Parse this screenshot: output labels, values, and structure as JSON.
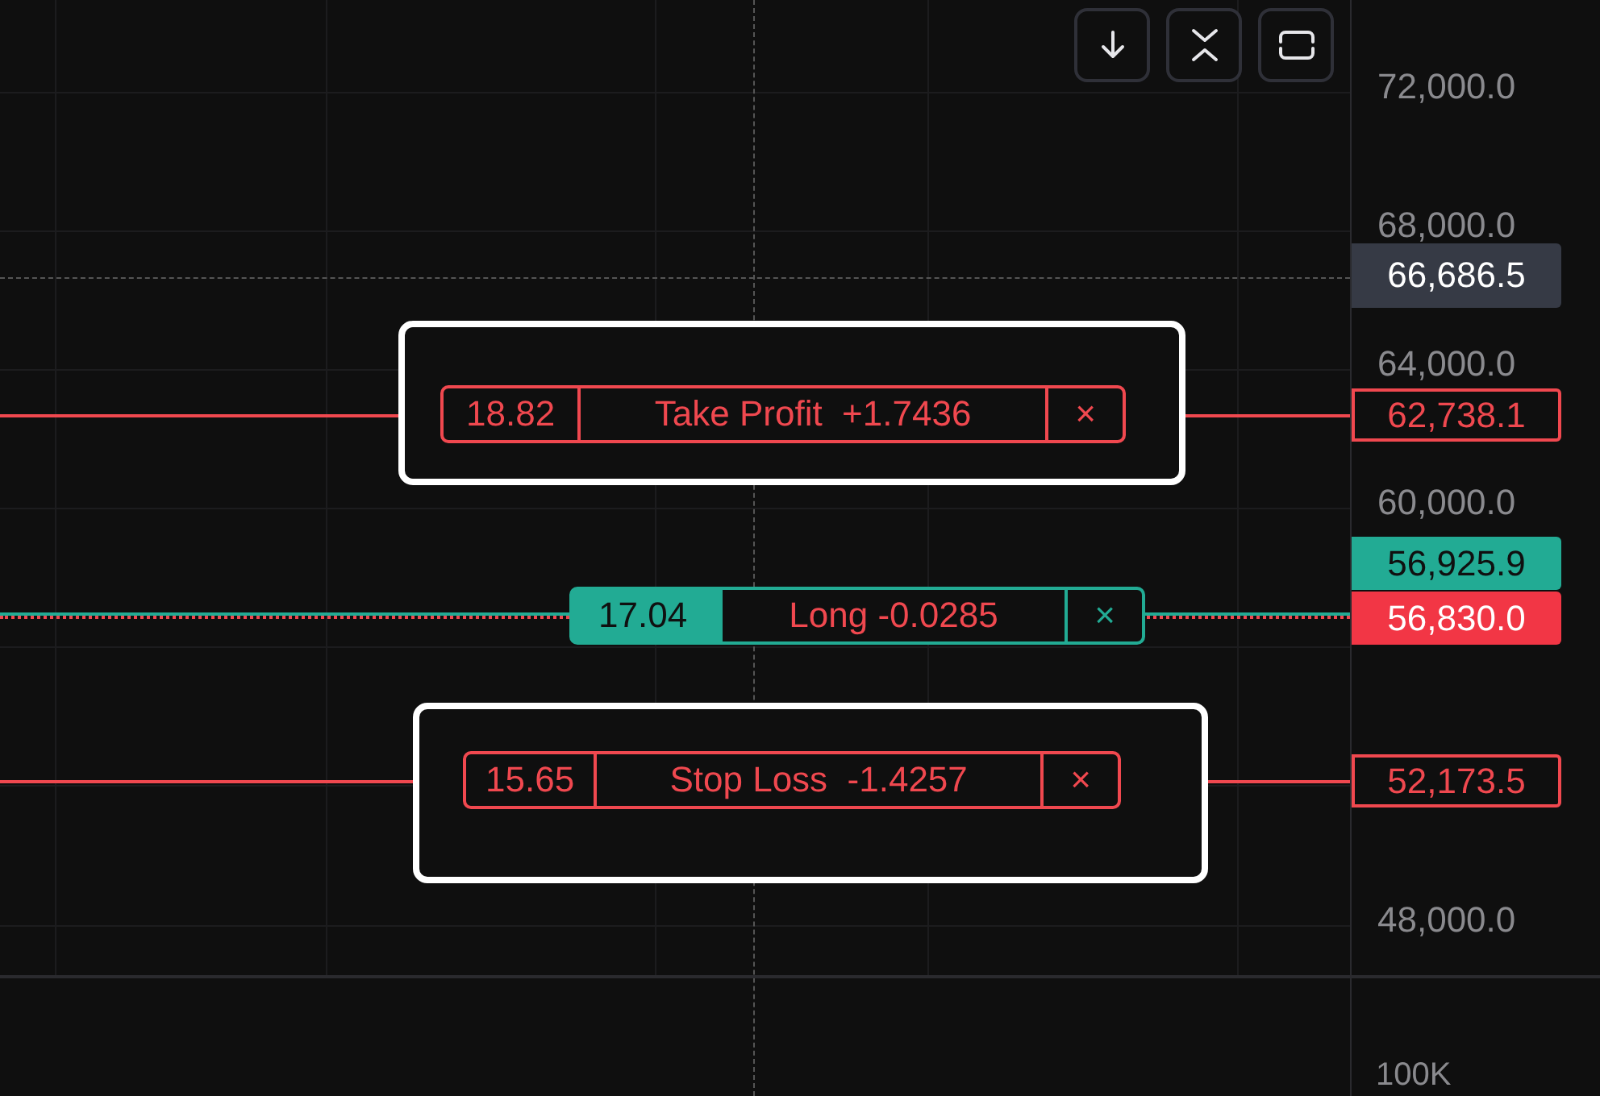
{
  "price_axis": {
    "ticks": [
      "72,000.0",
      "68,000.0",
      "64,000.0",
      "60,000.0",
      "48,000.0"
    ],
    "crosshair_price": "66,686.5",
    "last_price": "56,830.0"
  },
  "orders": [
    {
      "kind": "take_profit",
      "quantity": "18.82",
      "label": "Take Profit  +1.7436",
      "close": "×",
      "price": "62,738.1",
      "highlighted": true
    },
    {
      "kind": "position",
      "quantity": "17.04",
      "label": "Long -0.0285",
      "close": "×",
      "price": "56,925.9",
      "highlighted": false
    },
    {
      "kind": "stop_loss",
      "quantity": "15.65",
      "label": "Stop Loss  -1.4257",
      "close": "×",
      "price": "52,173.5",
      "highlighted": true
    }
  ],
  "volume_axis": {
    "tick": "100K"
  }
}
